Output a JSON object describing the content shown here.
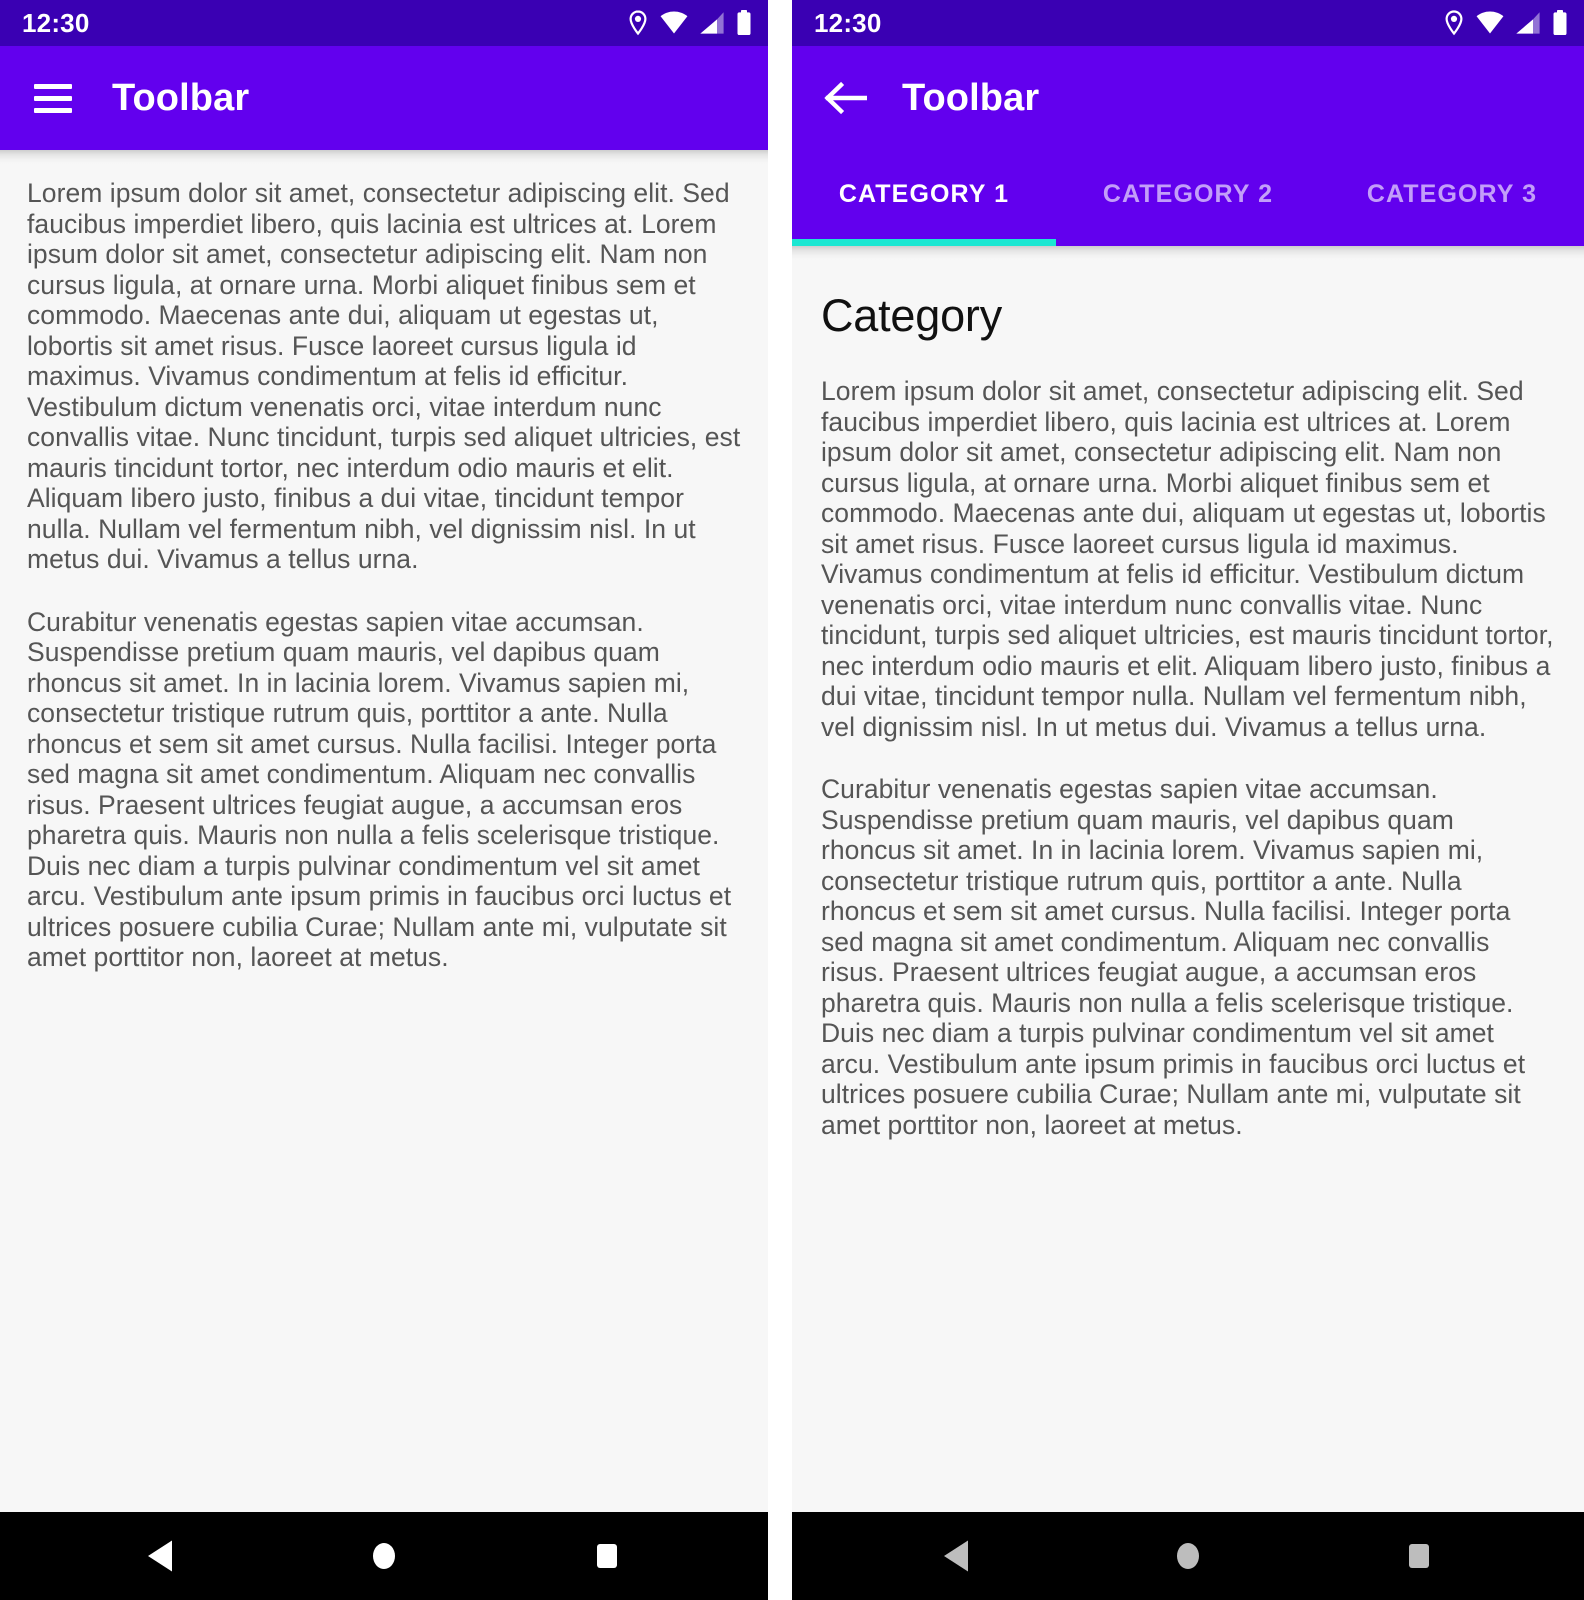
{
  "theme": {
    "status_bar_color": "#3A00B3",
    "toolbar_color": "#6200EE",
    "tab_indicator_color": "#1BE7D2",
    "content_bg_color": "#F7F7F7",
    "body_text_color": "#555555",
    "nav_bar_color": "#000000",
    "nav_icon_color_left": "#FFFFFF",
    "nav_icon_color_right": "#BDBDBD"
  },
  "status_bar": {
    "time": "12:30",
    "icons": [
      "location-icon",
      "wifi-icon",
      "signal-icon",
      "battery-icon"
    ]
  },
  "left_screen": {
    "toolbar": {
      "menu_icon": "hamburger-menu-icon",
      "title": "Toolbar"
    },
    "body": {
      "paragraph_1": "Lorem ipsum dolor sit amet, consectetur adipiscing elit. Sed faucibus imperdiet libero, quis lacinia est ultrices at. Lorem ipsum dolor sit amet, consectetur adipiscing elit. Nam non cursus ligula, at ornare urna. Morbi aliquet finibus sem et commodo. Maecenas ante dui, aliquam ut egestas ut, lobortis sit amet risus. Fusce laoreet cursus ligula id maximus. Vivamus condimentum at felis id efficitur. Vestibulum dictum venenatis orci, vitae interdum nunc convallis vitae. Nunc tincidunt, turpis sed aliquet ultricies, est mauris tincidunt tortor, nec interdum odio mauris et elit. Aliquam libero justo, finibus a dui vitae, tincidunt tempor nulla. Nullam vel fermentum nibh, vel dignissim nisl. In ut metus dui. Vivamus a tellus urna.",
      "paragraph_2": "Curabitur venenatis egestas sapien vitae accumsan. Suspendisse pretium quam mauris, vel dapibus quam rhoncus sit amet. In in lacinia lorem. Vivamus sapien mi, consectetur tristique rutrum quis, porttitor a ante. Nulla rhoncus et sem sit amet cursus. Nulla facilisi. Integer porta sed magna sit amet condimentum. Aliquam nec convallis risus. Praesent ultrices feugiat augue, a accumsan eros pharetra quis. Mauris non nulla a felis scelerisque tristique. Duis nec diam a turpis pulvinar condimentum vel sit amet arcu. Vestibulum ante ipsum primis in faucibus orci luctus et ultrices posuere cubilia Curae; Nullam ante mi, vulputate sit amet porttitor non, laoreet at metus."
    },
    "nav_bar": {
      "back_label": "back-triangle-icon",
      "home_label": "home-circle-icon",
      "recents_label": "recents-square-icon"
    }
  },
  "right_screen": {
    "toolbar": {
      "back_icon": "back-arrow-icon",
      "title": "Toolbar"
    },
    "tabs": [
      {
        "label": "CATEGORY 1",
        "active": true
      },
      {
        "label": "CATEGORY 2",
        "active": false
      },
      {
        "label": "CATEGORY 3",
        "active": false
      }
    ],
    "heading": "Category",
    "body": {
      "paragraph_1": "Lorem ipsum dolor sit amet, consectetur adipiscing elit. Sed faucibus imperdiet libero, quis lacinia est ultrices at. Lorem ipsum dolor sit amet, consectetur adipiscing elit. Nam non cursus ligula, at ornare urna. Morbi aliquet finibus sem et commodo. Maecenas ante dui, aliquam ut egestas ut, lobortis sit amet risus. Fusce laoreet cursus ligula id maximus. Vivamus condimentum at felis id efficitur. Vestibulum dictum venenatis orci, vitae interdum nunc convallis vitae. Nunc tincidunt, turpis sed aliquet ultricies, est mauris tincidunt tortor, nec interdum odio mauris et elit. Aliquam libero justo, finibus a dui vitae, tincidunt tempor nulla. Nullam vel fermentum nibh, vel dignissim nisl. In ut metus dui. Vivamus a tellus urna.",
      "paragraph_2": "Curabitur venenatis egestas sapien vitae accumsan. Suspendisse pretium quam mauris, vel dapibus quam rhoncus sit amet. In in lacinia lorem. Vivamus sapien mi, consectetur tristique rutrum quis, porttitor a ante. Nulla rhoncus et sem sit amet cursus. Nulla facilisi. Integer porta sed magna sit amet condimentum. Aliquam nec convallis risus. Praesent ultrices feugiat augue, a accumsan eros pharetra quis. Mauris non nulla a felis scelerisque tristique. Duis nec diam a turpis pulvinar condimentum vel sit amet arcu. Vestibulum ante ipsum primis in faucibus orci luctus et ultrices posuere cubilia Curae; Nullam ante mi, vulputate sit amet porttitor non, laoreet at metus."
    },
    "nav_bar": {
      "back_label": "back-triangle-icon",
      "home_label": "home-circle-icon",
      "recents_label": "recents-square-icon"
    }
  }
}
